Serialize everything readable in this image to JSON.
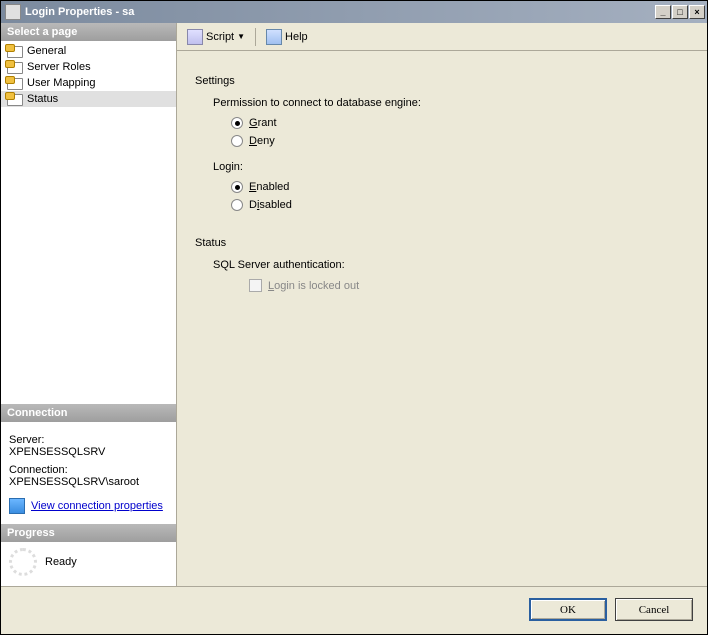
{
  "window": {
    "title": "Login Properties - sa"
  },
  "sidebar": {
    "header": "Select a page",
    "items": [
      {
        "label": "General"
      },
      {
        "label": "Server Roles"
      },
      {
        "label": "User Mapping"
      },
      {
        "label": "Status"
      }
    ],
    "connection_header": "Connection",
    "server_label": "Server:",
    "server_value": "XPENSESSQLSRV",
    "connection_label": "Connection:",
    "connection_value": "XPENSESSQLSRV\\saroot",
    "view_connection": "View connection properties",
    "progress_header": "Progress",
    "progress_status": "Ready"
  },
  "toolbar": {
    "script": "Script",
    "help": "Help"
  },
  "main": {
    "settings_title": "Settings",
    "perm_label": "Permission to connect to database engine:",
    "grant": "Grant",
    "deny": "Deny",
    "login_label": "Login:",
    "enabled": "Enabled",
    "disabled": "Disabled",
    "status_title": "Status",
    "sql_auth": "SQL Server authentication:",
    "locked_out": "Login is locked out"
  },
  "buttons": {
    "ok": "OK",
    "cancel": "Cancel"
  }
}
